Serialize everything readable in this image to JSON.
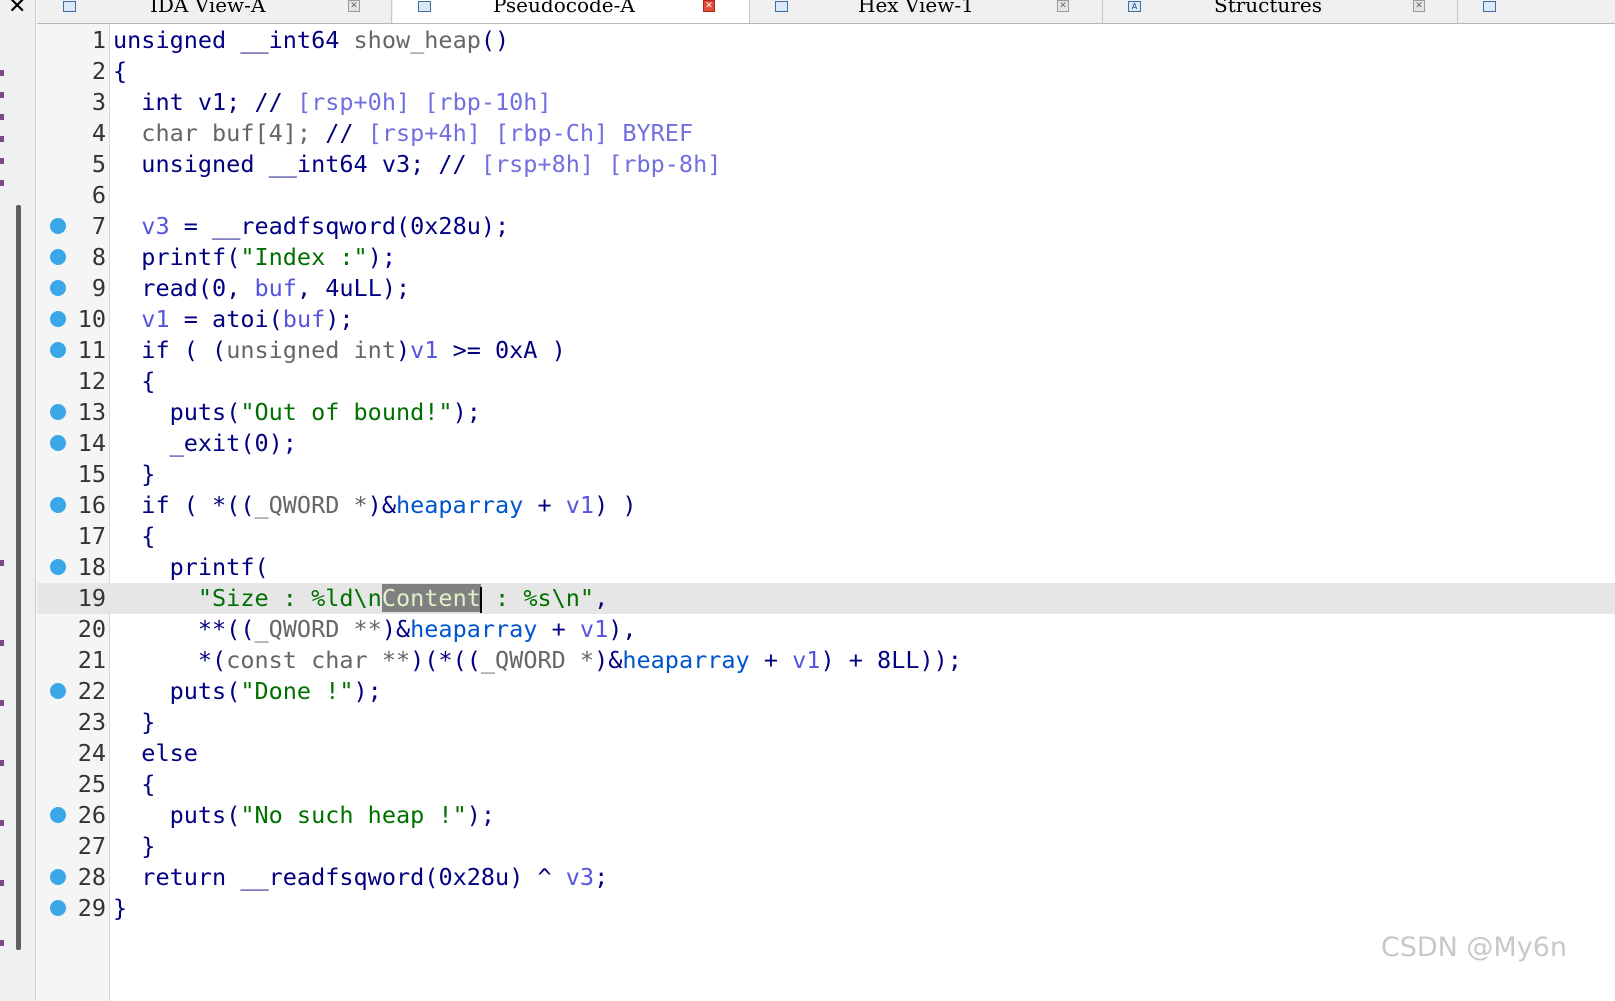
{
  "tabs": [
    {
      "label": "IDA View-A",
      "icon": "disassembly-icon",
      "active": false
    },
    {
      "label": "Pseudocode-A",
      "icon": "pseudocode-icon",
      "active": true
    },
    {
      "label": "Hex View-1",
      "icon": "hex-icon",
      "active": false
    },
    {
      "label": "Structures",
      "icon": "structures-icon",
      "active": false
    },
    {
      "label": "",
      "icon": "enums-icon",
      "active": false
    }
  ],
  "left_strip": {
    "close_glyph": "✕"
  },
  "icon_glyphs": {
    "structures": "A"
  },
  "code": {
    "function_name": "show_heap",
    "current_line": 19,
    "breakpoint_lines": [
      7,
      8,
      9,
      10,
      11,
      13,
      14,
      16,
      18,
      22,
      26,
      28,
      29
    ],
    "lines": [
      [
        [
          "k",
          "unsigned __int64 "
        ],
        [
          "t",
          "show_heap"
        ],
        [
          "p",
          "()"
        ]
      ],
      [
        [
          "p",
          "{"
        ]
      ],
      [
        [
          "k",
          "  int v1; // "
        ],
        [
          "c",
          "[rsp+0h] [rbp-10h]"
        ]
      ],
      [
        [
          "t",
          "  char buf[4]; "
        ],
        [
          "k",
          "// "
        ],
        [
          "c",
          "[rsp+4h] [rbp-Ch] BYREF"
        ]
      ],
      [
        [
          "k",
          "  unsigned __int64 v3; // "
        ],
        [
          "c",
          "[rsp+8h] [rbp-8h]"
        ]
      ],
      [],
      [
        [
          "v",
          "  v3"
        ],
        [
          "p",
          " = "
        ],
        [
          "f",
          "__readfsqword"
        ],
        [
          "p",
          "("
        ],
        [
          "n",
          "0x28u"
        ],
        [
          "p",
          ");"
        ]
      ],
      [
        [
          "f",
          "  printf"
        ],
        [
          "p",
          "("
        ],
        [
          "s",
          "\"Index :\""
        ],
        [
          "p",
          ");"
        ]
      ],
      [
        [
          "f",
          "  read"
        ],
        [
          "p",
          "("
        ],
        [
          "n",
          "0"
        ],
        [
          "p",
          ", "
        ],
        [
          "v",
          "buf"
        ],
        [
          "p",
          ", "
        ],
        [
          "n",
          "4uLL"
        ],
        [
          "p",
          ");"
        ]
      ],
      [
        [
          "v",
          "  v1"
        ],
        [
          "p",
          " = "
        ],
        [
          "f",
          "atoi"
        ],
        [
          "p",
          "("
        ],
        [
          "v",
          "buf"
        ],
        [
          "p",
          ");"
        ]
      ],
      [
        [
          "k",
          "  if"
        ],
        [
          "p",
          " ( ("
        ],
        [
          "t",
          "unsigned int"
        ],
        [
          "p",
          ")"
        ],
        [
          "v",
          "v1"
        ],
        [
          "p",
          " >= "
        ],
        [
          "n",
          "0xA"
        ],
        [
          "p",
          " )"
        ]
      ],
      [
        [
          "p",
          "  {"
        ]
      ],
      [
        [
          "f",
          "    puts"
        ],
        [
          "p",
          "("
        ],
        [
          "s",
          "\"Out of bound!\""
        ],
        [
          "p",
          ");"
        ]
      ],
      [
        [
          "f",
          "    _exit"
        ],
        [
          "p",
          "("
        ],
        [
          "n",
          "0"
        ],
        [
          "p",
          ");"
        ]
      ],
      [
        [
          "p",
          "  }"
        ]
      ],
      [
        [
          "k",
          "  if"
        ],
        [
          "p",
          " ( *(("
        ],
        [
          "t",
          "_QWORD *"
        ],
        [
          "p",
          ")&"
        ],
        [
          "g",
          "heaparray"
        ],
        [
          "p",
          " + "
        ],
        [
          "v",
          "v1"
        ],
        [
          "p",
          ") )"
        ]
      ],
      [
        [
          "p",
          "  {"
        ]
      ],
      [
        [
          "f",
          "    printf"
        ],
        [
          "p",
          "("
        ]
      ],
      [
        [
          "s",
          "      \"Size : %ld\\n"
        ],
        [
          "hl",
          "Content"
        ],
        [
          "caret",
          ""
        ],
        [
          "s",
          " : %s\\n\""
        ],
        [
          "p",
          ","
        ]
      ],
      [
        [
          "p",
          "      **(("
        ],
        [
          "t",
          "_QWORD **"
        ],
        [
          "p",
          ")&"
        ],
        [
          "g",
          "heaparray"
        ],
        [
          "p",
          " + "
        ],
        [
          "v",
          "v1"
        ],
        [
          "p",
          "),"
        ]
      ],
      [
        [
          "p",
          "      *("
        ],
        [
          "t",
          "const char **"
        ],
        [
          "p",
          ")(*(("
        ],
        [
          "t",
          "_QWORD *"
        ],
        [
          "p",
          ")&"
        ],
        [
          "g",
          "heaparray"
        ],
        [
          "p",
          " + "
        ],
        [
          "v",
          "v1"
        ],
        [
          "p",
          ") + "
        ],
        [
          "n",
          "8LL"
        ],
        [
          "p",
          "));"
        ]
      ],
      [
        [
          "f",
          "    puts"
        ],
        [
          "p",
          "("
        ],
        [
          "s",
          "\"Done !\""
        ],
        [
          "p",
          ");"
        ]
      ],
      [
        [
          "p",
          "  }"
        ]
      ],
      [
        [
          "k",
          "  else"
        ]
      ],
      [
        [
          "p",
          "  {"
        ]
      ],
      [
        [
          "f",
          "    puts"
        ],
        [
          "p",
          "("
        ],
        [
          "s",
          "\"No such heap !\""
        ],
        [
          "p",
          ");"
        ]
      ],
      [
        [
          "p",
          "  }"
        ]
      ],
      [
        [
          "k",
          "  return "
        ],
        [
          "f",
          "__readfsqword"
        ],
        [
          "p",
          "("
        ],
        [
          "n",
          "0x28u"
        ],
        [
          "p",
          ") ^ "
        ],
        [
          "v",
          "v3"
        ],
        [
          "p",
          ";"
        ]
      ],
      [
        [
          "p",
          "}"
        ]
      ]
    ]
  },
  "watermark": "CSDN @My6n",
  "colors": {
    "breakpoint": "#3aa8e8",
    "string": "#007000",
    "comment_addr": "#7070e0",
    "variable": "#5555dd",
    "global": "#0055cc",
    "current_line_bg": "#e6e6e6"
  }
}
